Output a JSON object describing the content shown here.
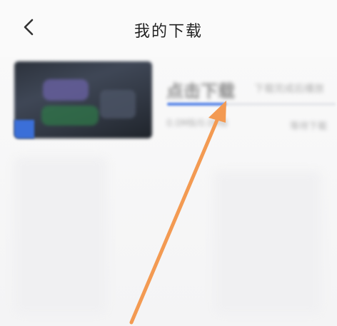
{
  "header": {
    "title": "我的下载",
    "back_icon": "chevron-left-icon"
  },
  "download_item": {
    "title": "点击下载",
    "subtitle": "下载完成后播放",
    "size": "0.0MB/0.0MB",
    "status": "等待下载",
    "progress": 0.35,
    "accent_color": "#4f7fe6"
  },
  "annotation": {
    "arrow_color": "#f39a52",
    "arrow_icon": "arrow-up-right-icon"
  }
}
